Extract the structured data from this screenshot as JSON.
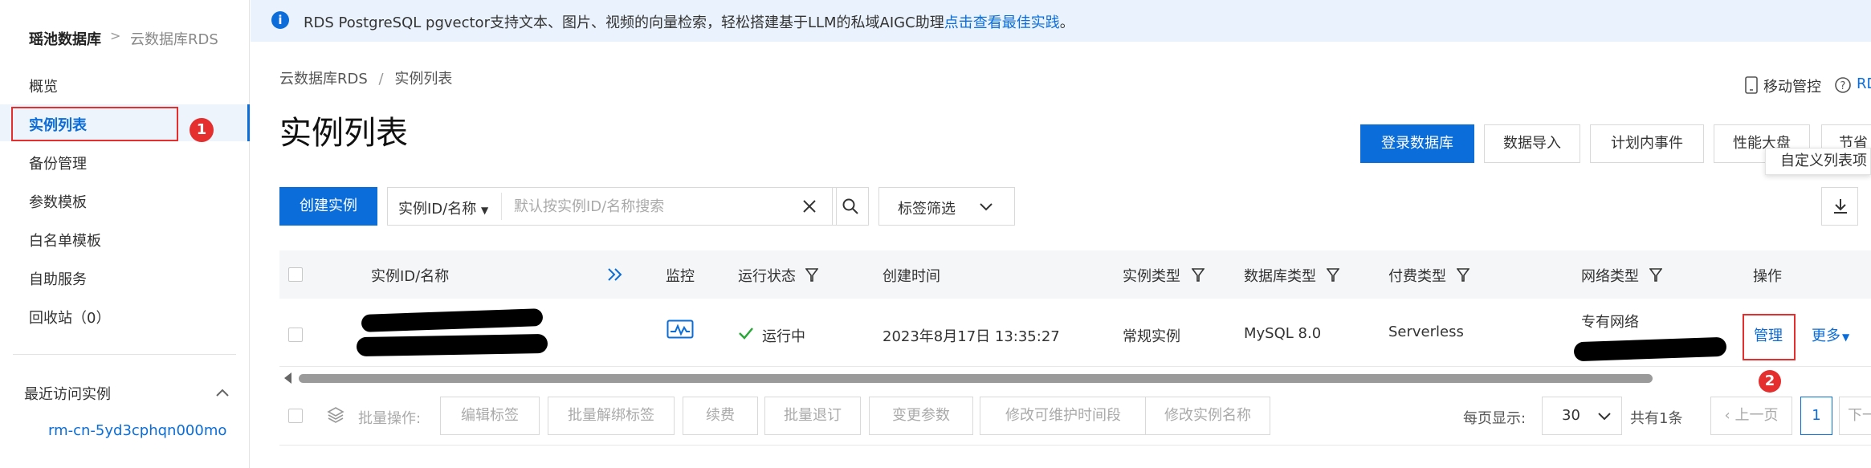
{
  "sidebar": {
    "brand": "瑶池数据库",
    "brand_sep": ">",
    "brand_sub": "云数据库RDS",
    "items": [
      {
        "label": "概览"
      },
      {
        "label": "实例列表"
      },
      {
        "label": "备份管理"
      },
      {
        "label": "参数模板"
      },
      {
        "label": "白名单模板"
      },
      {
        "label": "自助服务"
      },
      {
        "label": "回收站（0）"
      }
    ],
    "recent_title": "最近访问实例",
    "recent_items": [
      "rm-cn-5yd3cphqn000mo"
    ],
    "badge_1": "1"
  },
  "banner": {
    "text": "RDS PostgreSQL pgvector支持文本、图片、视频的向量检索，轻松搭建基于LLM的私域AIGC助理",
    "link": "点击查看最佳实践",
    "suffix": "。"
  },
  "breadcrumb": {
    "root": "云数据库RDS",
    "sep": "/",
    "current": "实例列表"
  },
  "page_title": "实例列表",
  "top_links": {
    "mobile": "移动管控",
    "help": "RD"
  },
  "actions": {
    "login_db": "登录数据库",
    "import": "数据导入",
    "events": "计划内事件",
    "perf": "性能大盘",
    "save": "节省"
  },
  "tooltip": "自定义列表项",
  "toolbar": {
    "create": "创建实例",
    "search_field": "实例ID/名称",
    "search_placeholder": "默认按实例ID/名称搜索",
    "tag_filter": "标签筛选"
  },
  "table": {
    "headers": {
      "id": "实例ID/名称",
      "monitor": "监控",
      "status": "运行状态",
      "created": "创建时间",
      "instance_type": "实例类型",
      "db_type": "数据库类型",
      "pay_type": "付费类型",
      "network": "网络类型",
      "ops": "操作"
    },
    "rows": [
      {
        "status": "运行中",
        "created": "2023年8月17日 13:35:27",
        "instance_type": "常规实例",
        "db_type": "MySQL 8.0",
        "pay_type": "Serverless",
        "network": "专有网络",
        "manage": "管理",
        "more": "更多",
        "badge_2": "2"
      }
    ]
  },
  "footer": {
    "batch_label": "批量操作:",
    "batch_buttons": [
      "编辑标签",
      "批量解绑标签",
      "续费",
      "批量退订",
      "变更参数",
      "修改可维护时间段",
      "修改实例名称"
    ],
    "per_page_label": "每页显示:",
    "per_page": "30",
    "total": "共有1条",
    "prev": "上一页",
    "page": "1",
    "next": "下一"
  },
  "colors": {
    "primary": "#0a6dd9",
    "annotation_red": "#e52e2e",
    "success": "#2aa839"
  }
}
